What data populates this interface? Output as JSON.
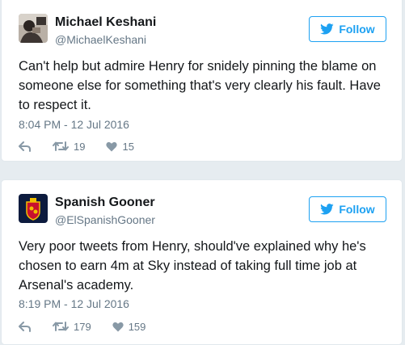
{
  "tweets": [
    {
      "author_name": "Michael Keshani",
      "author_handle": "@MichaelKeshani",
      "follow_label": "Follow",
      "text": "Can't help but admire Henry for snidely pinning the blame on someone else for something that's very clearly his fault. Have to respect it.",
      "timestamp": "8:04 PM - 12 Jul 2016",
      "retweets": "19",
      "likes": "15"
    },
    {
      "author_name": "Spanish Gooner",
      "author_handle": "@ElSpanishGooner",
      "follow_label": "Follow",
      "text": "Very poor tweets from Henry, should've explained why he's chosen to earn 4m at Sky instead of taking full time job at Arsenal's academy.",
      "timestamp": "8:19 PM - 12 Jul 2016",
      "retweets": "179",
      "likes": "159"
    }
  ],
  "colors": {
    "accent": "#1da1f2",
    "muted": "#657786",
    "text": "#14171a",
    "background": "#e6ecf0"
  },
  "icons": {
    "reply": "reply-icon",
    "retweet": "retweet-icon",
    "like": "heart-icon",
    "follow": "twitter-bird-icon"
  }
}
